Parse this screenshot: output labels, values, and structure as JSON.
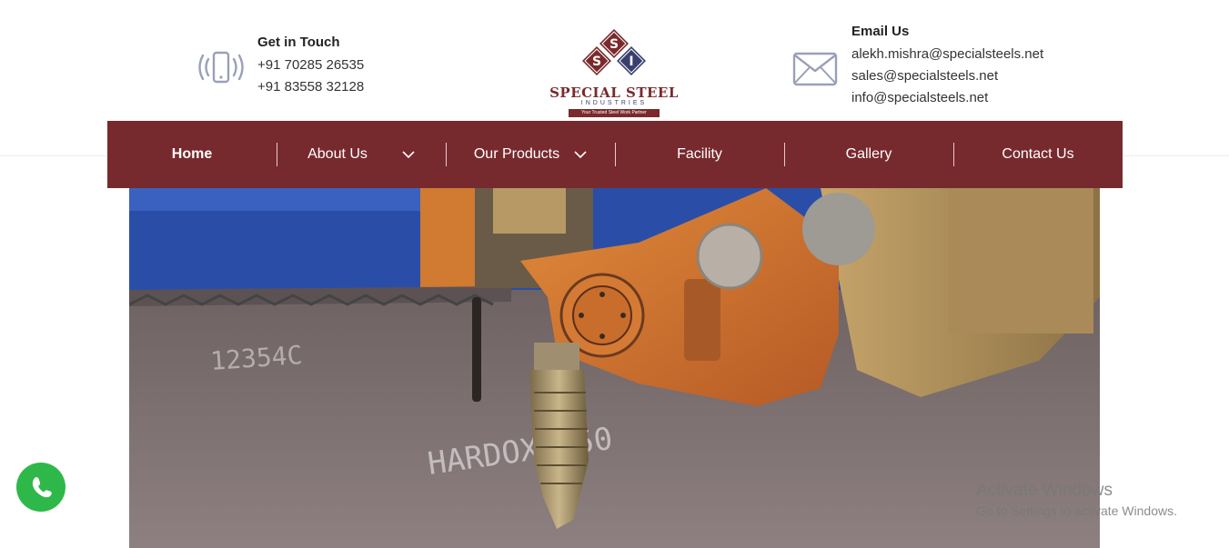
{
  "header": {
    "phone": {
      "title": "Get in Touch",
      "lines": [
        "+91 70285 26535",
        "+91 83558 32128"
      ],
      "icon": "smartphone-icon"
    },
    "logo": {
      "letters": [
        "S",
        "S",
        "I"
      ],
      "name": "SPECIAL STEEL",
      "subname": "INDUSTRIES",
      "tagline": "Your Trusted Steel Work Partner",
      "colors": {
        "maroon": "#7a2a2c",
        "navy": "#3a3f6e"
      }
    },
    "email": {
      "title": "Email Us",
      "lines": [
        "alekh.mishra@specialsteels.net",
        "sales@specialsteels.net",
        "info@specialsteels.net"
      ],
      "icon": "envelope-icon"
    }
  },
  "nav": {
    "background": "#772a2e",
    "items": [
      {
        "label": "Home",
        "active": true,
        "dropdown": false
      },
      {
        "label": "About Us",
        "active": false,
        "dropdown": true
      },
      {
        "label": "Our Products",
        "active": false,
        "dropdown": true
      },
      {
        "label": "Facility",
        "active": false,
        "dropdown": false
      },
      {
        "label": "Gallery",
        "active": false,
        "dropdown": false
      },
      {
        "label": "Contact Us",
        "active": false,
        "dropdown": false
      }
    ]
  },
  "hero": {
    "description": "laser-cutting-machine-photo",
    "plate_text": [
      "12354C",
      "HARDOX 450"
    ]
  },
  "whatsapp": {
    "icon": "whatsapp-icon",
    "color": "#2fb84a"
  },
  "watermark": {
    "title": "Activate Windows",
    "subtitle": "Go to Settings to activate Windows."
  }
}
